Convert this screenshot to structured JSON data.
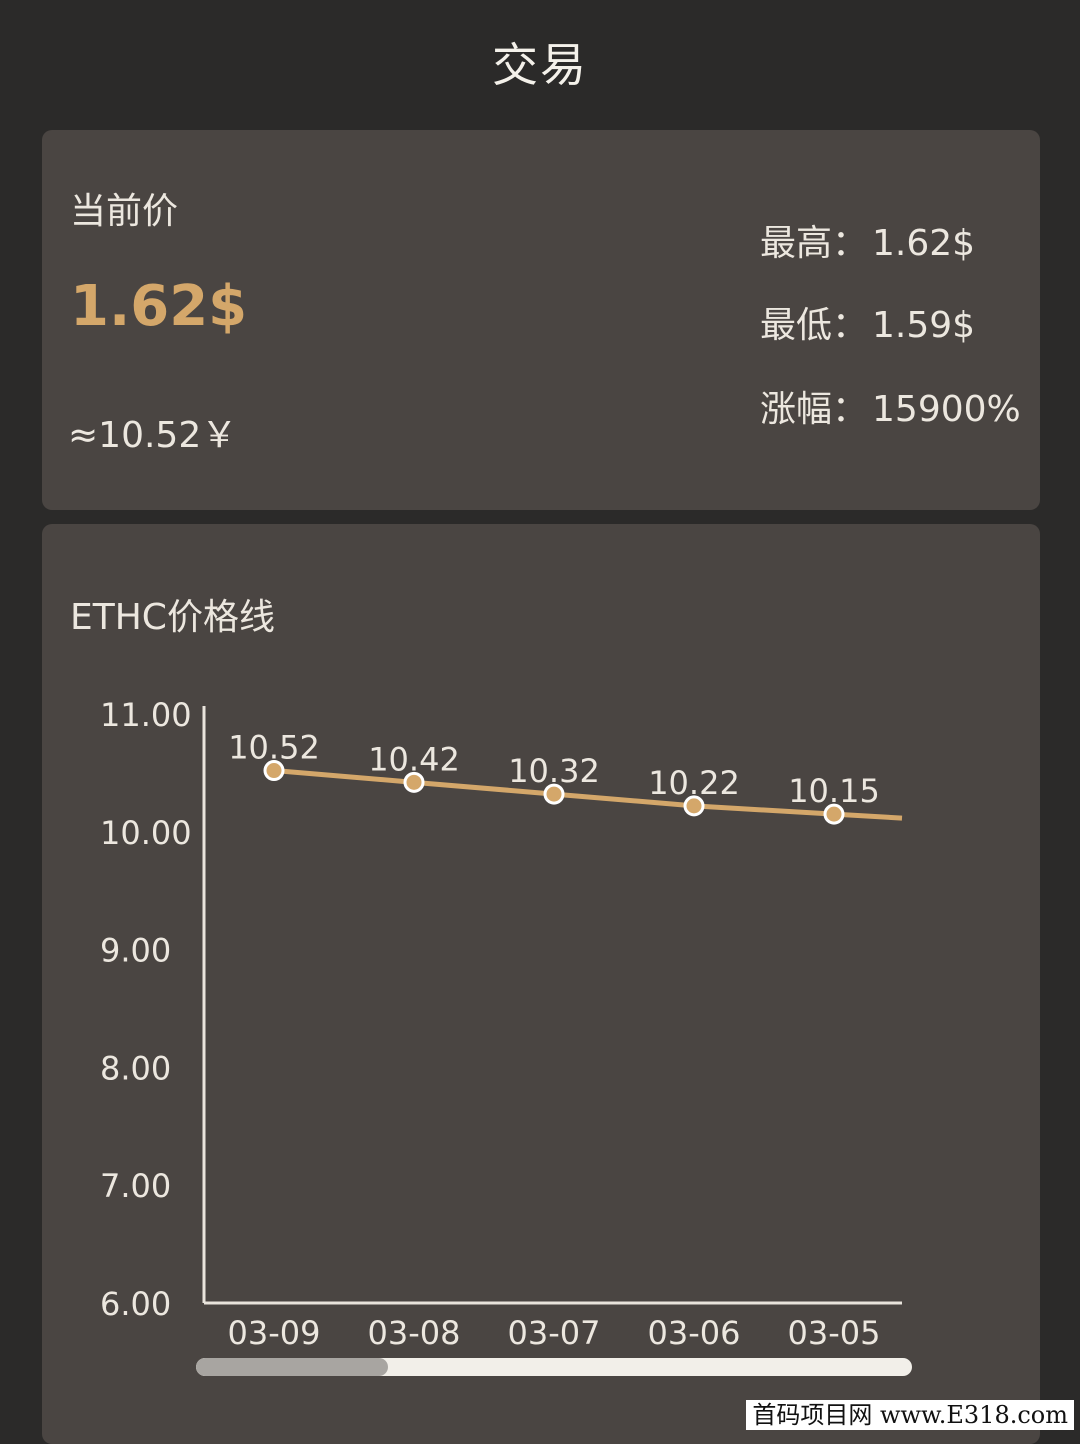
{
  "header": {
    "title": "交易"
  },
  "price_card": {
    "current_label": "当前价",
    "current_price": "1.62$",
    "approx_cny": "≈10.52￥",
    "high_label": "最高：",
    "high_value": "1.62$",
    "low_label": "最低：",
    "low_value": "1.59$",
    "change_label": "涨幅：",
    "change_value": "15900%"
  },
  "chart_card": {
    "title": "ETHC价格线"
  },
  "chart_data": {
    "type": "line",
    "categories": [
      "03-09",
      "03-08",
      "03-07",
      "03-06",
      "03-05"
    ],
    "values": [
      10.52,
      10.42,
      10.32,
      10.22,
      10.15
    ],
    "value_labels": [
      "10.52",
      "10.42",
      "10.32",
      "10.22",
      "10.15"
    ],
    "y_ticks": [
      "11.00",
      "10.00",
      "9.00",
      "8.00",
      "7.00",
      "6.00"
    ],
    "ylim": [
      6,
      11
    ],
    "line_color": "#d4a76a",
    "grid": false
  },
  "watermark": "首码项目网 www.E318.com",
  "colors": {
    "background": "#2b2a29",
    "card": "#4a4542",
    "accent": "#d4a76a"
  }
}
